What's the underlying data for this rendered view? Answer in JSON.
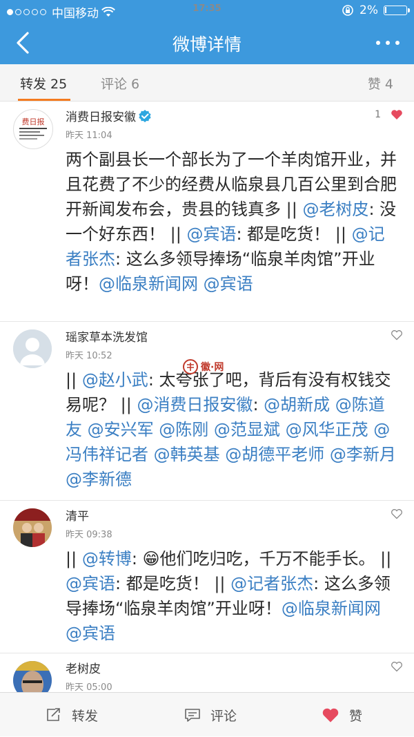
{
  "status_bar": {
    "carrier": "中国移动",
    "time": "17:35",
    "battery": "2%"
  },
  "header": {
    "title": "微博详情"
  },
  "tabs": [
    {
      "label": "转发 25"
    },
    {
      "label": "评论 6"
    },
    {
      "label": "赞 4"
    }
  ],
  "posts": [
    {
      "author": "消费日报安徽",
      "verified": true,
      "time": "昨天 11:04",
      "likes": "1",
      "liked": true,
      "segments": [
        {
          "t": "两个副县长一个部长为了一个羊肉馆开业，并且花费了不少的经费从临泉县几百公里到合肥开新闻发布会，贵县的钱真多 || "
        },
        {
          "t": "@老树皮",
          "link": true
        },
        {
          "t": ": 没一个好东西！ || "
        },
        {
          "t": "@宾语",
          "link": true
        },
        {
          "t": ": 都是吃货！ || "
        },
        {
          "t": "@记者张杰",
          "link": true
        },
        {
          "t": ": 这么多领导捧场“临泉羊肉馆”开业呀！"
        },
        {
          "t": "@临泉新闻网",
          "link": true
        },
        {
          "t": " "
        },
        {
          "t": "@宾语",
          "link": true
        }
      ]
    },
    {
      "author": "瑶家草本洗发馆",
      "verified": false,
      "time": "昨天 10:52",
      "likes": "",
      "liked": false,
      "segments": [
        {
          "t": "|| "
        },
        {
          "t": "@赵小武",
          "link": true
        },
        {
          "t": ": 太夸张了吧，背后有没有权钱交易呢？ || "
        },
        {
          "t": "@消费日报安徽",
          "link": true
        },
        {
          "t": ": "
        },
        {
          "t": "@胡新成",
          "link": true
        },
        {
          "t": " "
        },
        {
          "t": "@陈道友",
          "link": true
        },
        {
          "t": " "
        },
        {
          "t": "@安兴军",
          "link": true
        },
        {
          "t": " "
        },
        {
          "t": "@陈刚",
          "link": true
        },
        {
          "t": " "
        },
        {
          "t": "@范显斌",
          "link": true
        },
        {
          "t": " "
        },
        {
          "t": "@风华正茂",
          "link": true
        },
        {
          "t": " "
        },
        {
          "t": "@冯伟祥记者",
          "link": true
        },
        {
          "t": " "
        },
        {
          "t": "@韩英基",
          "link": true
        },
        {
          "t": " "
        },
        {
          "t": "@胡德平老师",
          "link": true
        },
        {
          "t": " "
        },
        {
          "t": "@李新月",
          "link": true
        },
        {
          "t": " "
        },
        {
          "t": "@李新德",
          "link": true
        }
      ]
    },
    {
      "author": "清平",
      "verified": false,
      "time": "昨天 09:38",
      "likes": "",
      "liked": false,
      "segments": [
        {
          "t": "|| "
        },
        {
          "t": "@转博",
          "link": true
        },
        {
          "t": ": 😁他们吃归吃，千万不能手长。 || "
        },
        {
          "t": "@宾语",
          "link": true
        },
        {
          "t": ": 都是吃货！ || "
        },
        {
          "t": "@记者张杰",
          "link": true
        },
        {
          "t": ": 这么多领导捧场“临泉羊肉馆”开业呀！"
        },
        {
          "t": "@临泉新闻网",
          "link": true
        },
        {
          "t": " "
        },
        {
          "t": "@宾语",
          "link": true
        }
      ]
    },
    {
      "author": "老树皮",
      "verified": false,
      "time": "昨天 05:00",
      "likes": "",
      "liked": false,
      "segments": []
    }
  ],
  "watermark": "徽·网",
  "bottom_bar": {
    "repost": "转发",
    "comment": "评论",
    "like": "赞"
  },
  "colors": {
    "header_bg": "#3d99dd",
    "link": "#3b7fc3",
    "heart": "#e64a5f",
    "tab_indicator": "#f47b20"
  }
}
